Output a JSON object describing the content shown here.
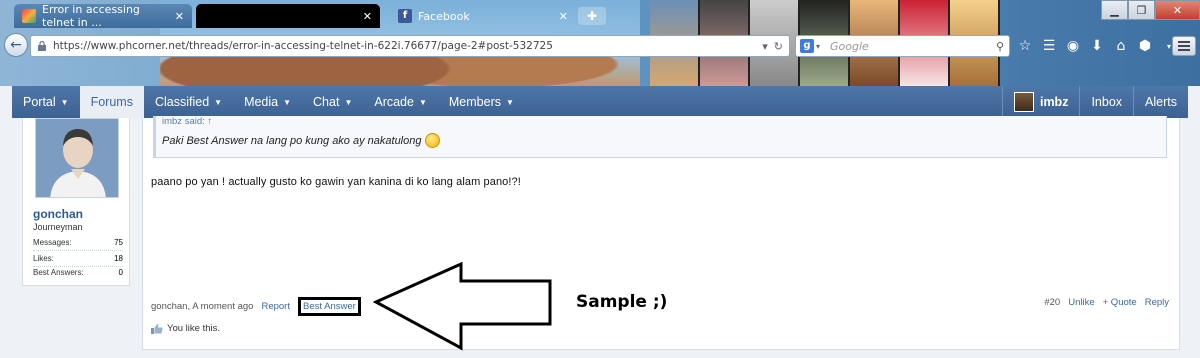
{
  "browser": {
    "tabs": [
      {
        "title": "Error in accessing telnet in ...",
        "state": "active"
      },
      {
        "title": "",
        "state": "redacted"
      },
      {
        "title": "Facebook",
        "state": "normal"
      }
    ],
    "url_host": "https://www.phcorner.net",
    "url_path": "/threads/error-in-accessing-telnet-in-622i.76677/page-2#post-532725",
    "search_engine": "g",
    "search_placeholder": "Google"
  },
  "forum_nav": {
    "items": [
      {
        "label": "Portal",
        "has_menu": true
      },
      {
        "label": "Forums",
        "active": true
      },
      {
        "label": "Classified",
        "has_menu": true
      },
      {
        "label": "Media",
        "has_menu": true
      },
      {
        "label": "Chat",
        "has_menu": true
      },
      {
        "label": "Arcade",
        "has_menu": true
      },
      {
        "label": "Members",
        "has_menu": true
      }
    ],
    "right": {
      "username": "imbz",
      "inbox": "Inbox",
      "alerts": "Alerts"
    }
  },
  "poster": {
    "username": "gonchan",
    "title": "Journeyman",
    "stats": [
      {
        "label": "Messages:",
        "value": "75"
      },
      {
        "label": "Likes:",
        "value": "18"
      },
      {
        "label": "Best Answers:",
        "value": "0"
      }
    ]
  },
  "post": {
    "quote_header": "imbz said: ↑",
    "quote_text": "Paki Best Answer na lang po kung ako ay nakatulong",
    "message": "paano po yan ! actually gusto ko gawin yan kanina di ko lang alam pano!?!",
    "meta": "gonchan, A moment ago",
    "report": "Report",
    "best_answer": "Best Answer",
    "post_number": "#20",
    "unlike": "Unlike",
    "quote": "+ Quote",
    "reply": "Reply",
    "likes_text": "You like this."
  },
  "annotation": {
    "text": "Sample ;)"
  },
  "colors": {
    "nav": "#4a6fa0",
    "link": "#3a6aa0",
    "active_nav_text": "#3d6ba0"
  }
}
